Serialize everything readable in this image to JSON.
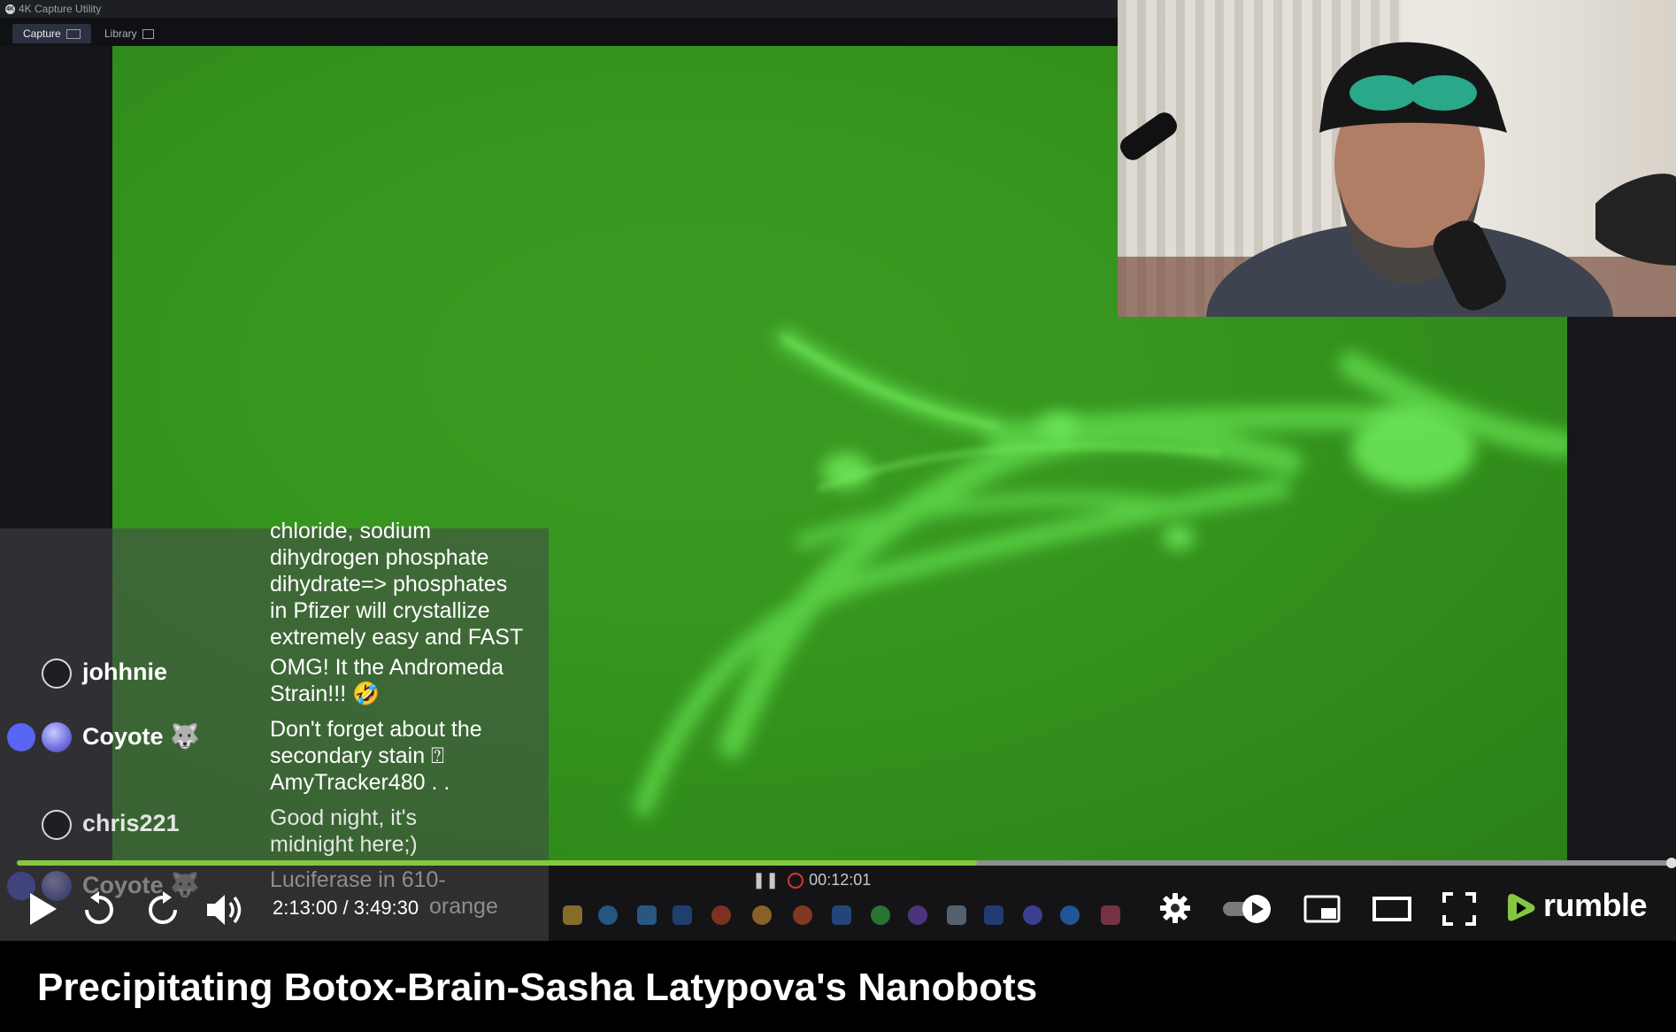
{
  "capture_window": {
    "title": "4K Capture Utility",
    "logo": "4K",
    "tabs": [
      {
        "label": "Capture",
        "icon": "screen-icon",
        "active": true
      },
      {
        "label": "Library",
        "icon": "grid-icon",
        "active": false
      }
    ]
  },
  "chat": {
    "messages": [
      {
        "user": "",
        "text": "chloride, sodium dihydrogen phosphate dihydrate=> phosphates in Pfizer will crystallize extremely easy and FAST",
        "lines": [
          "chloride, sodium",
          "dihydrogen phosphate",
          "dihydrate=> phosphates",
          "in Pfizer will crystallize",
          "extremely easy and FAST"
        ]
      },
      {
        "user": "johhnie",
        "avatar": "user-icon",
        "lines": [
          "OMG! It the Andromeda",
          "Strain!!! 🤣"
        ]
      },
      {
        "user": "Coyote 🐺",
        "avatar": "orb-avatar",
        "badge": "discord-icon",
        "lines": [
          "Don't forget about the",
          "secondary stain ⍰",
          "AmyTracker480 . ."
        ]
      },
      {
        "user": "chris221",
        "avatar": "user-icon",
        "lines": [
          "Good night, it's",
          "midnight here;)"
        ]
      },
      {
        "user": "Coyote 🐺",
        "avatar": "orb-avatar",
        "badge": "discord-icon",
        "lines": [
          "Luciferase in 610-",
          "orange"
        ]
      }
    ]
  },
  "recording": {
    "status": "paused",
    "elapsed": "00:12:01"
  },
  "player": {
    "current_time": "2:13:00",
    "duration": "3:49:30",
    "time_display": "2:13:00 / 3:49:30",
    "progress_fraction": 0.58,
    "brand": "rumble",
    "accent": "#85c742"
  },
  "video": {
    "title": "Precipitating Botox-Brain-Sasha Latypova's Nanobots"
  },
  "colors": {
    "progress_fill": "#85c742",
    "progress_track": "#8f8f8f",
    "green_field": "#36961f"
  }
}
